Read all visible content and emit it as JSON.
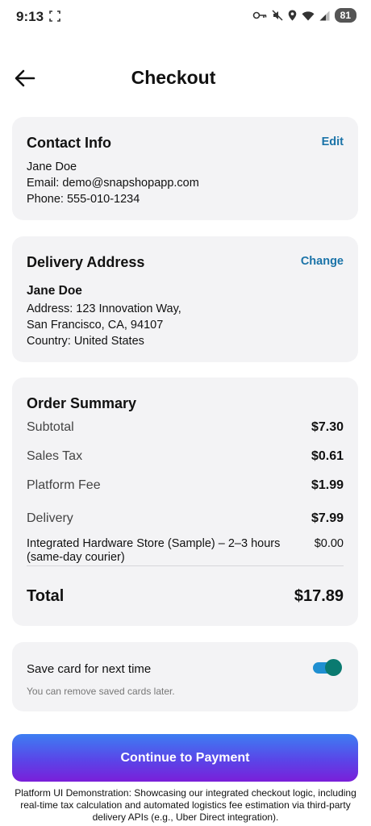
{
  "status_bar": {
    "time": "9:13",
    "battery": "81"
  },
  "header": {
    "title": "Checkout"
  },
  "contact": {
    "title": "Contact Info",
    "action": "Edit",
    "name": "Jane Doe",
    "email": "Email: demo@snapshopapp.com",
    "phone": "Phone: 555-010-1234"
  },
  "delivery_address": {
    "title": "Delivery Address",
    "action": "Change",
    "name": "Jane Doe",
    "address_line1": "Address: 123 Innovation Way,",
    "address_line2": "San Francisco, CA, 94107",
    "country": "Country: United States"
  },
  "order_summary": {
    "title": "Order Summary",
    "rows": [
      {
        "label": "Subtotal",
        "value": "$7.30"
      },
      {
        "label": "Sales Tax",
        "value": "$0.61"
      },
      {
        "label": "Platform Fee",
        "value": "$1.99"
      },
      {
        "label": "Delivery",
        "value": "$7.99"
      }
    ],
    "store_line": {
      "label": "Integrated Hardware Store (Sample) – 2–3 hours (same-day courier)",
      "value": "$0.00"
    },
    "total": {
      "label": "Total",
      "value": "$17.89"
    }
  },
  "save_card": {
    "label": "Save card for next time",
    "hint": "You can remove saved cards later.",
    "enabled": true
  },
  "pay_button": {
    "label": "Continue to Payment"
  },
  "disclaimer": "Platform UI Demonstration: Showcasing our integrated checkout logic, including real-time tax calculation and automated logistics fee estimation via third-party delivery APIs (e.g., Uber Direct integration).",
  "colors": {
    "accent": "#1a73a8",
    "card_bg": "#f3f3f5",
    "toggle_track": "#1f8fd1",
    "toggle_knob": "#0a7a70"
  },
  "icons": [
    "screen-record-icon",
    "vpn-key-icon",
    "mute-icon",
    "location-icon",
    "wifi-icon",
    "signal-icon",
    "back-arrow-icon"
  ]
}
